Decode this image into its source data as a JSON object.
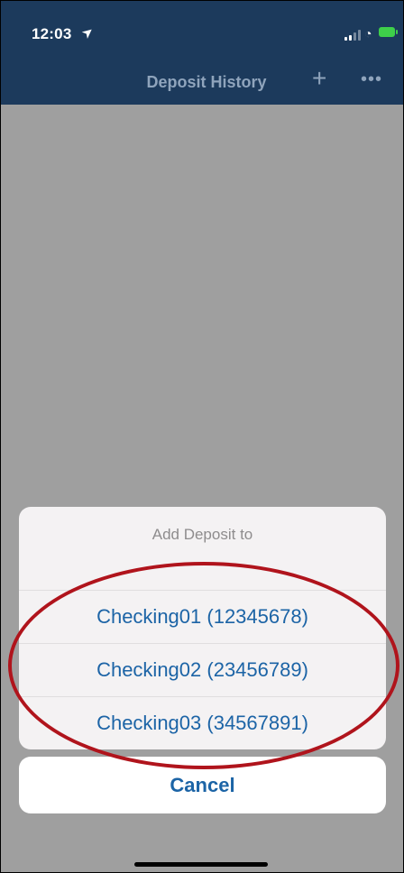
{
  "status": {
    "time": "12:03"
  },
  "nav": {
    "title": "Deposit History"
  },
  "sheet": {
    "title": "Add Deposit to",
    "options": [
      "Checking01 (12345678)",
      "Checking02 (23456789)",
      "Checking03 (34567891)"
    ],
    "cancel": "Cancel"
  },
  "colors": {
    "nav_bar": "#1c3a5c",
    "overlay": "#9f9f9f",
    "accent": "#1c64a6",
    "highlight_ring": "#b0141c"
  },
  "icons": [
    "location-arrow-icon",
    "cellular-signal-icon",
    "wifi-icon",
    "battery-icon",
    "plus-icon",
    "more-icon"
  ]
}
